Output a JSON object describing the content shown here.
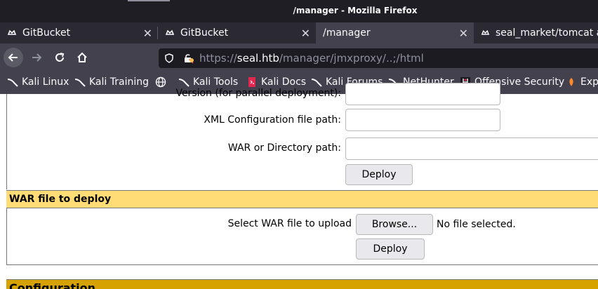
{
  "window": {
    "title": "/manager - Mozilla Firefox"
  },
  "tabs": [
    {
      "label": "GitBucket",
      "close": "✕"
    },
    {
      "label": "GitBucket",
      "close": "✕"
    },
    {
      "label": "/manager",
      "close": "✕"
    },
    {
      "label": "seal_market/tomcat at"
    }
  ],
  "nav": {
    "url_scheme": "https://",
    "url_host": "seal.htb",
    "url_path": "/manager/jmxproxy/..;/html"
  },
  "bookmarks": [
    {
      "label": "Kali Linux",
      "icon": "kali-dragon-icon"
    },
    {
      "label": "Kali Training",
      "icon": "kali-dragon-icon"
    },
    {
      "label": "",
      "icon": "globe-icon"
    },
    {
      "label": "Kali Tools",
      "icon": "kali-dragon-icon"
    },
    {
      "label": "Kali Docs",
      "icon": "kali-docs-icon"
    },
    {
      "label": "Kali Forums",
      "icon": "kali-dragon-icon"
    },
    {
      "label": "NetHunter",
      "icon": "kali-dragon-icon"
    },
    {
      "label": "Offensive Security",
      "icon": "offsec-icon"
    },
    {
      "label": "Exp",
      "icon": "exploit-db-icon"
    }
  ],
  "deploy_form": {
    "version_label": "Version (for parallel deployment):",
    "xml_label": "XML Configuration file path:",
    "war_dir_label": "WAR or Directory path:",
    "deploy_button": "Deploy"
  },
  "war_section": {
    "header": "WAR file to deploy",
    "select_label": "Select WAR file to upload",
    "browse_button": "Browse...",
    "no_file": "No file selected.",
    "deploy_button": "Deploy"
  },
  "config_section": {
    "header": "Configuration"
  },
  "colors": {
    "section_header": "#ffdc75",
    "config_header": "#d5a200",
    "chrome_dark": "#2b2a33",
    "toolbar": "#42414d"
  }
}
